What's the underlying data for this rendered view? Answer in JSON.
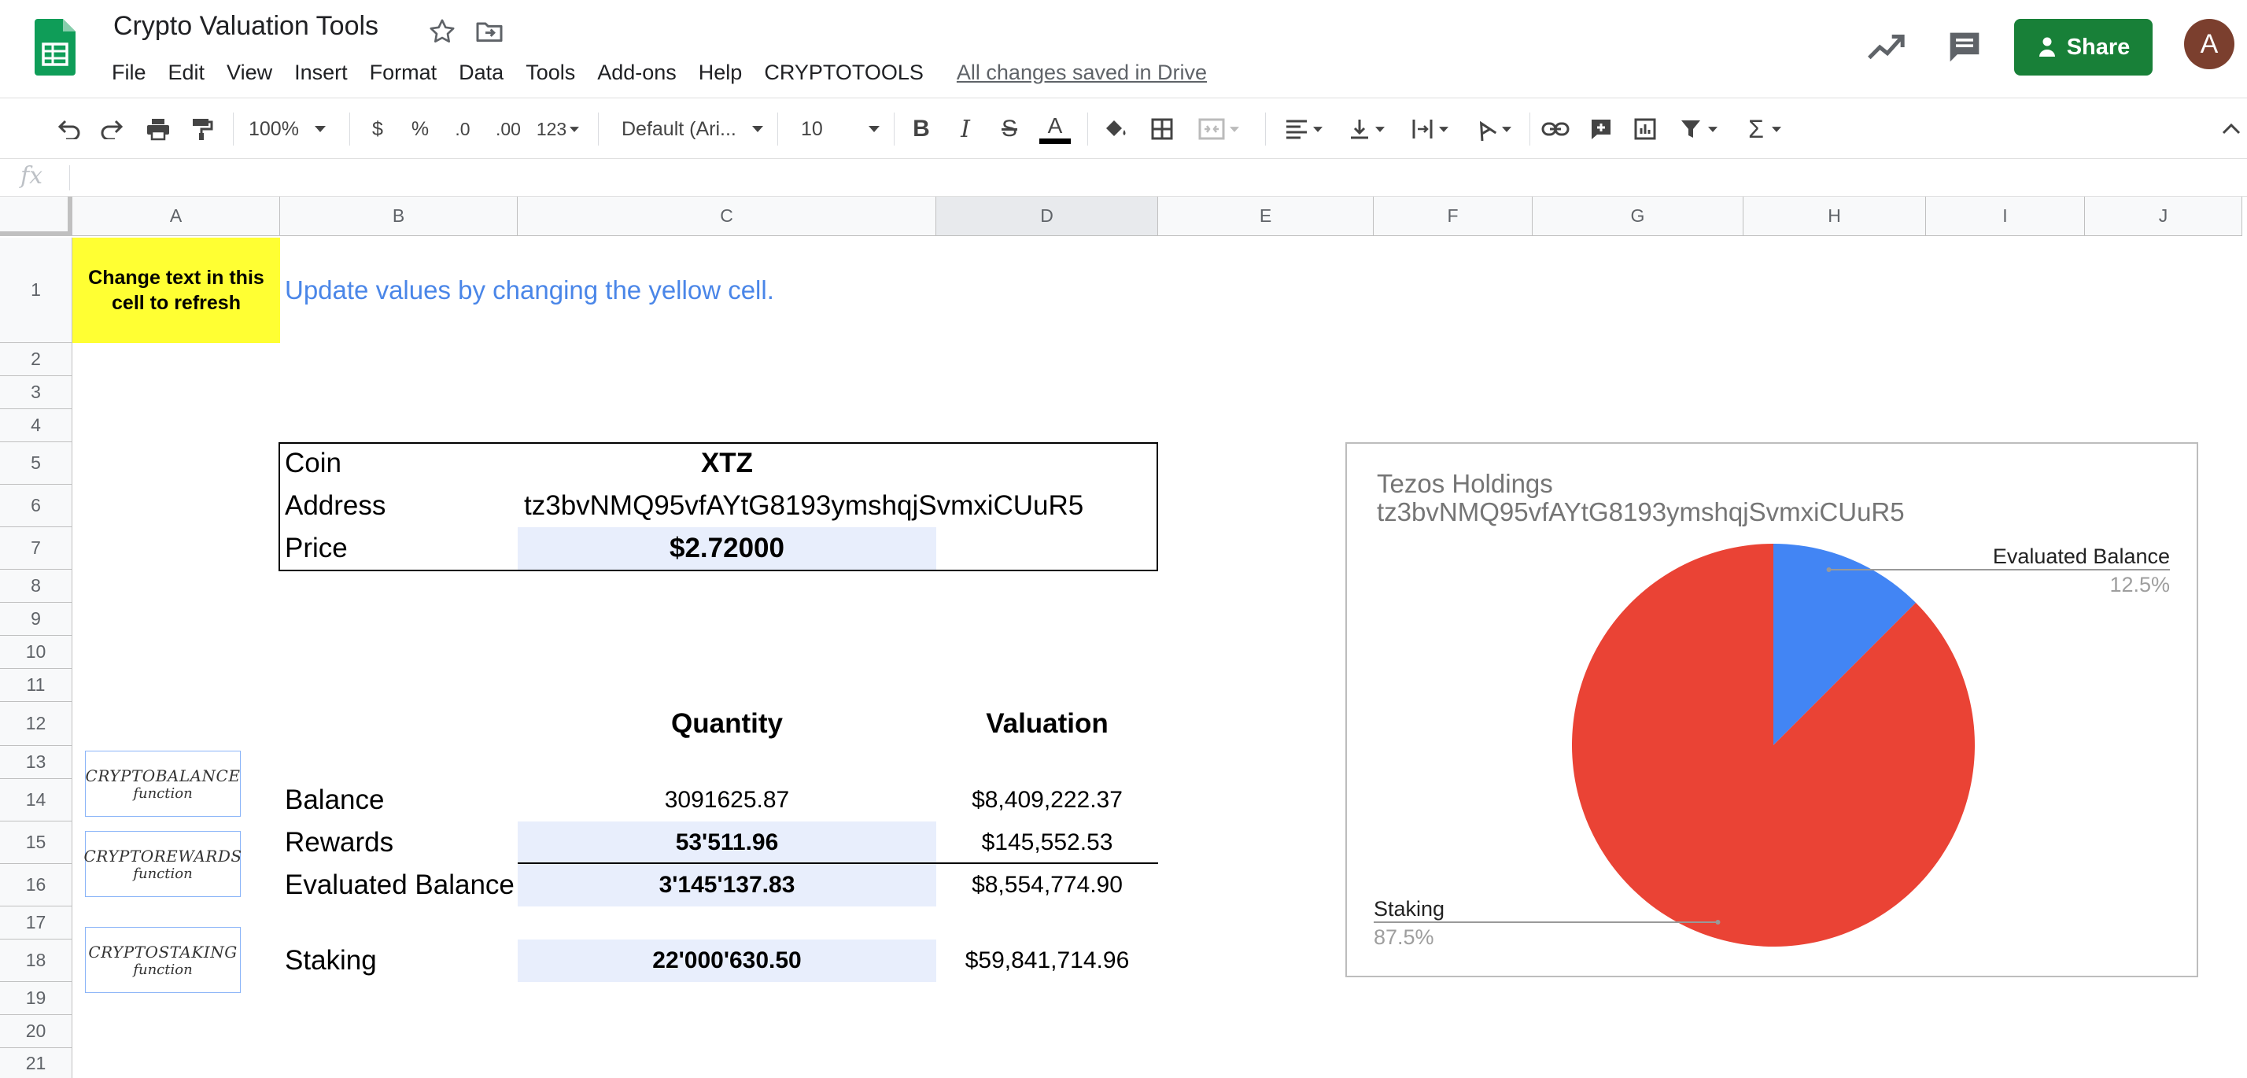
{
  "header": {
    "title": "Crypto Valuation Tools",
    "menu": [
      "File",
      "Edit",
      "View",
      "Insert",
      "Format",
      "Data",
      "Tools",
      "Add-ons",
      "Help",
      "CRYPTOTOOLS"
    ],
    "save_status": "All changes saved in Drive",
    "share_label": "Share",
    "avatar_letter": "A",
    "share_color": "#188038"
  },
  "toolbar": {
    "zoom": "100%",
    "currency": "$",
    "percent": "%",
    "decrease_decimals": ".0",
    "increase_decimals": ".00",
    "more_formats": "123",
    "font": "Default (Ari...",
    "font_size": "10",
    "bold": "B",
    "italic": "I",
    "strike": "S",
    "text_color": "A",
    "sum": "Σ"
  },
  "formula_bar": {
    "fx": "fx"
  },
  "grid": {
    "columns": [
      "A",
      "B",
      "C",
      "D",
      "E",
      "F",
      "G",
      "H",
      "I",
      "J"
    ],
    "rows": [
      "1",
      "2",
      "3",
      "4",
      "5",
      "6",
      "7",
      "8",
      "9",
      "10",
      "11",
      "12",
      "13",
      "14",
      "15",
      "16",
      "17",
      "18",
      "19",
      "20",
      "21"
    ]
  },
  "sheet": {
    "yellow_cell": "Change text in this cell  to refresh",
    "instructions": "Update values by changing the yellow cell.",
    "coin_label": "Coin",
    "coin_value": "XTZ",
    "address_label": "Address",
    "address_value": "tz3bvNMQ95vfAYtG8193ymshqjSvmxiCUuR5",
    "price_label": "Price",
    "price_value": "$2.72000",
    "quantity_header": "Quantity",
    "valuation_header": "Valuation",
    "rows": [
      {
        "label": "Balance",
        "quantity": "3091625.87",
        "valuation": "$8,409,222.37"
      },
      {
        "label": "Rewards",
        "quantity": "53'511.96",
        "valuation": "$145,552.53"
      },
      {
        "label": "Evaluated Balance",
        "quantity": "3'145'137.83",
        "valuation": "$8,554,774.90"
      },
      {
        "label": "Staking",
        "quantity": "22'000'630.50",
        "valuation": "$59,841,714.96"
      }
    ],
    "functions": [
      {
        "name": "CRYPTOBALANCE",
        "sub": "function"
      },
      {
        "name": "CRYPTOREWARDS",
        "sub": "function"
      },
      {
        "name": "CRYPTOSTAKING",
        "sub": "function"
      }
    ],
    "highlight_color": "#ffff33",
    "shade_color": "#e8eefc"
  },
  "chart_data": {
    "type": "pie",
    "title": "Tezos Holdings",
    "subtitle": "tz3bvNMQ95vfAYtG8193ymshqjSvmxiCUuR5",
    "slices": [
      {
        "label": "Evaluated Balance",
        "value": 12.5,
        "percent_label": "12.5%",
        "color": "#4285f4"
      },
      {
        "label": "Staking",
        "value": 87.5,
        "percent_label": "87.5%",
        "color": "#ea4335"
      }
    ]
  }
}
